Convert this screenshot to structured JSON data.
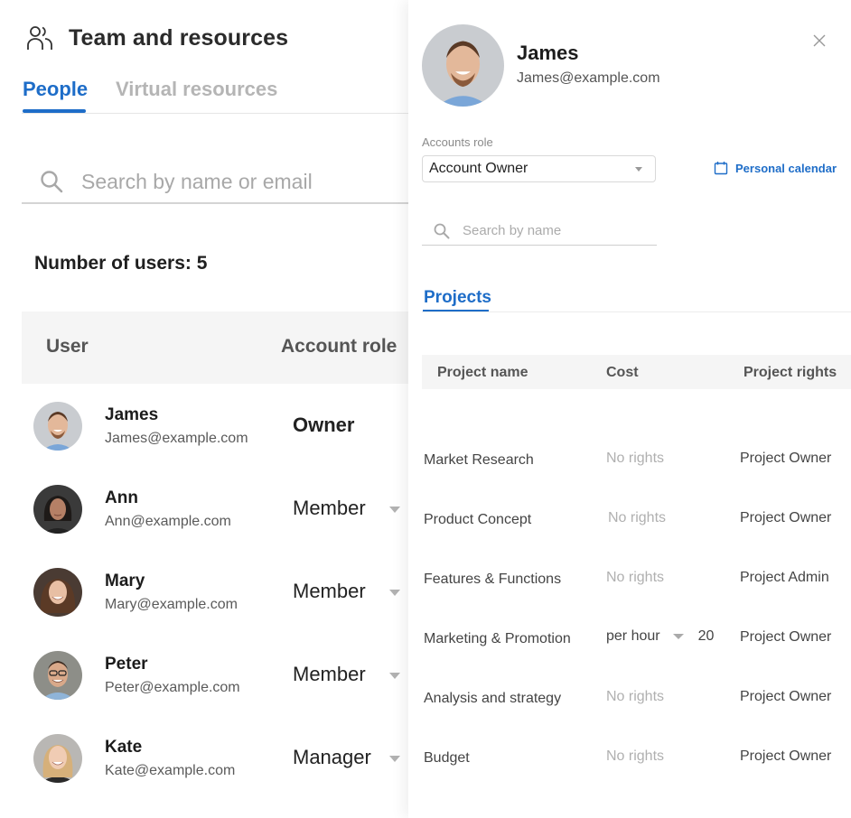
{
  "header": {
    "icon": "team-icon",
    "title": "Team and resources"
  },
  "tabs": [
    {
      "label": "People",
      "active": true
    },
    {
      "label": "Virtual resources",
      "active": false
    }
  ],
  "search": {
    "icon": "search-icon",
    "placeholder": "Search by name or email",
    "value": ""
  },
  "user_count_label": "Number of users: 5",
  "users_table": {
    "columns": [
      "User",
      "Account role"
    ],
    "rows": [
      {
        "name": "James",
        "email": "James@example.com",
        "role": "Owner",
        "editable": false
      },
      {
        "name": "Ann",
        "email": "Ann@example.com",
        "role": "Member",
        "editable": true
      },
      {
        "name": "Mary",
        "email": "Mary@example.com",
        "role": "Member",
        "editable": true
      },
      {
        "name": "Peter",
        "email": "Peter@example.com",
        "role": "Member",
        "editable": true
      },
      {
        "name": "Kate",
        "email": "Kate@example.com",
        "role": "Manager",
        "editable": true
      }
    ]
  },
  "detail_panel": {
    "name": "James",
    "email": "James@example.com",
    "close_icon": "close-icon",
    "accounts_role_label": "Accounts role",
    "accounts_role_value": "Account Owner",
    "calendar_link": {
      "icon": "calendar-icon",
      "label": "Personal calendar"
    },
    "search": {
      "icon": "search-icon",
      "placeholder": "Search by name",
      "value": ""
    },
    "tabs": [
      {
        "label": "Projects",
        "active": true
      }
    ],
    "projects_table": {
      "columns": [
        "Project name",
        "Cost",
        "Project rights"
      ],
      "rows": [
        {
          "name": "Market Research",
          "cost": "No rights",
          "rights": "Project Owner"
        },
        {
          "name": "Product Concept",
          "cost": "No rights",
          "rights": "Project Owner"
        },
        {
          "name": "Features & Functions",
          "cost": "No rights",
          "rights": "Project Admin"
        },
        {
          "name": "Marketing & Promotion",
          "cost_unit": "per hour",
          "cost_amount": "20",
          "rights": "Project Owner"
        },
        {
          "name": "Analysis and strategy",
          "cost": "No rights",
          "rights": "Project Owner"
        },
        {
          "name": "Budget",
          "cost": "No rights",
          "rights": "Project Owner"
        }
      ]
    }
  },
  "colors": {
    "accent": "#1e6dc8",
    "muted_text": "#b0b0b0",
    "header_bg": "#f5f5f5"
  }
}
